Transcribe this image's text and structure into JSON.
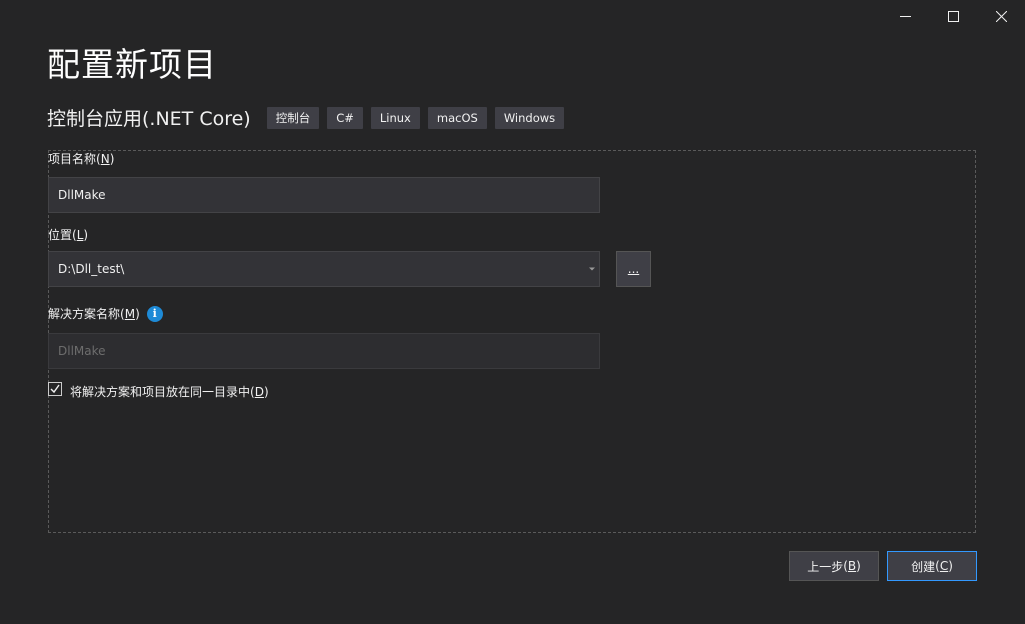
{
  "window": {
    "minimize_icon": "minimize-icon",
    "maximize_icon": "maximize-icon",
    "close_icon": "close-icon"
  },
  "page": {
    "title": "配置新项目"
  },
  "template": {
    "name": "控制台应用(.NET Core)",
    "tags": [
      "控制台",
      "C#",
      "Linux",
      "macOS",
      "Windows"
    ]
  },
  "form": {
    "project_name": {
      "label": "项目名称",
      "accelerator": "N",
      "value": "DllMake"
    },
    "location": {
      "label": "位置",
      "accelerator": "L",
      "value": "D:\\Dll_test\\",
      "browse_label": "..."
    },
    "solution_name": {
      "label": "解决方案名称",
      "accelerator": "M",
      "placeholder": "DllMake",
      "info_icon": "info-icon"
    },
    "same_dir": {
      "label": "将解决方案和项目放在同一目录中",
      "accelerator": "D",
      "checked": true
    }
  },
  "footer": {
    "back_label": "上一步",
    "back_accelerator": "B",
    "create_label": "创建",
    "create_accelerator": "C"
  },
  "colors": {
    "background": "#252526",
    "accent": "#3399ff",
    "info": "#1e8ad6"
  }
}
